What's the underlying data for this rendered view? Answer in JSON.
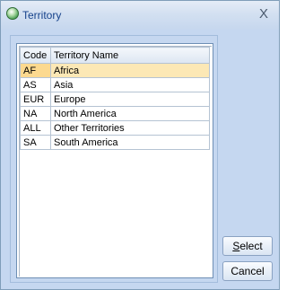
{
  "window": {
    "title": "Territory",
    "close_glyph": "X"
  },
  "grid": {
    "headers": {
      "code": "Code",
      "name": "Territory Name"
    },
    "rows": [
      {
        "code": "AF",
        "name": "Africa",
        "selected": true
      },
      {
        "code": "AS",
        "name": "Asia"
      },
      {
        "code": "EUR",
        "name": "Europe"
      },
      {
        "code": "NA",
        "name": "North America"
      },
      {
        "code": "ALL",
        "name": "Other Territories"
      },
      {
        "code": "SA",
        "name": "South America"
      }
    ]
  },
  "buttons": {
    "select_label_first": "S",
    "select_label_rest": "elect",
    "cancel_label": "Cancel"
  }
}
